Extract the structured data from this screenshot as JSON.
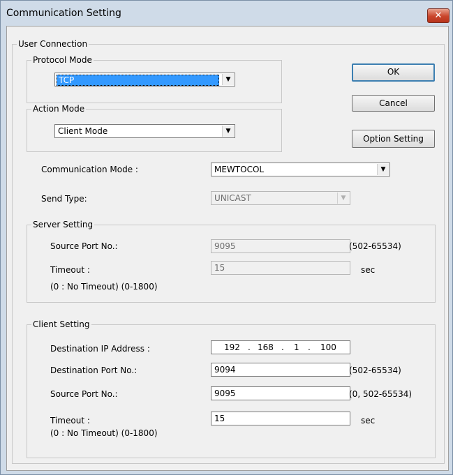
{
  "window": {
    "title": "Communication Setting",
    "close_glyph": "✕"
  },
  "user_connection": {
    "legend": "User Connection"
  },
  "protocol_mode": {
    "legend": "Protocol Mode",
    "value": "TCP"
  },
  "action_mode": {
    "legend": "Action Mode",
    "value": "Client Mode"
  },
  "buttons": {
    "ok": "OK",
    "cancel": "Cancel",
    "option": "Option Setting"
  },
  "comm_mode": {
    "label": "Communication Mode :",
    "value": "MEWTOCOL"
  },
  "send_type": {
    "label": "Send Type:",
    "value": "UNICAST"
  },
  "server": {
    "legend": "Server Setting",
    "source_port_label": "Source Port No.:",
    "source_port_value": "9095",
    "source_port_range": "(502-65534)",
    "timeout_label": "Timeout  :",
    "timeout_value": "15",
    "timeout_unit": "sec",
    "timeout_hint": "(0 : No Timeout)  (0-1800)"
  },
  "client": {
    "legend": "Client Setting",
    "dest_ip_label": "Destination IP Address :",
    "dest_ip": [
      "192",
      "168",
      "1",
      "100"
    ],
    "dest_port_label": "Destination Port No.:",
    "dest_port_value": "9094",
    "dest_port_range": "(502-65534)",
    "source_port_label": "Source Port No.:",
    "source_port_value": "9095",
    "source_port_range": "(0, 502-65534)",
    "timeout_label": "Timeout  :",
    "timeout_value": "15",
    "timeout_unit": "sec",
    "timeout_hint": "(0 : No Timeout)  (0-1800)"
  },
  "icons": {
    "dropdown": "chevron-down-icon",
    "close": "close-icon"
  }
}
